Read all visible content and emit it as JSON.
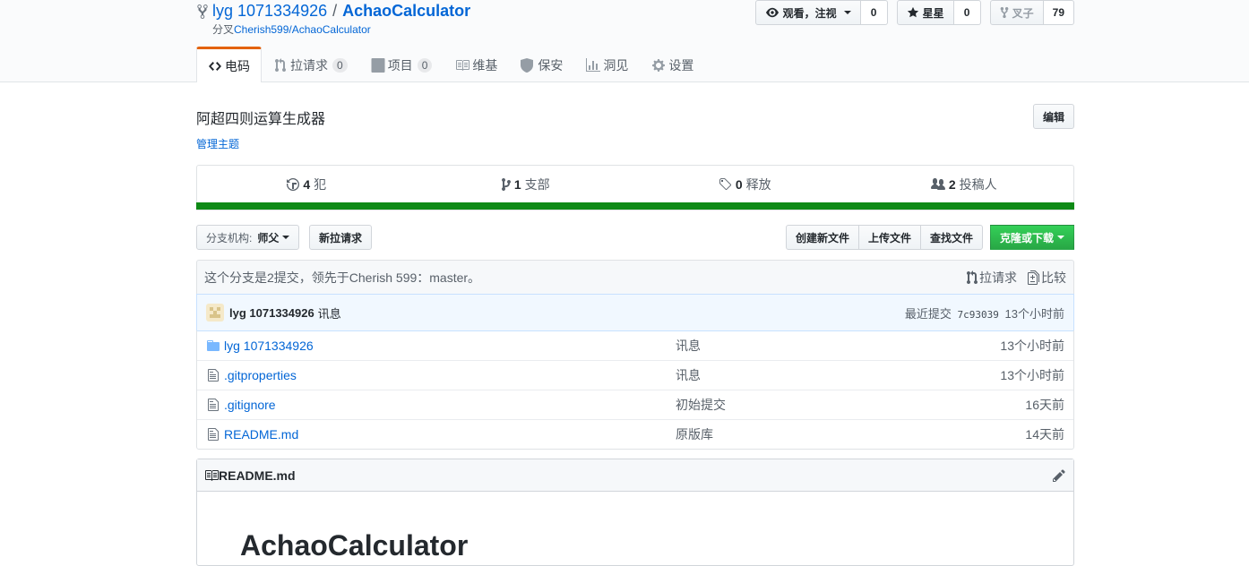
{
  "repo": {
    "owner": "lyg 1071334926",
    "separator": "/",
    "name": "AchaoCalculator",
    "forked_prefix": "分叉",
    "forked_from": "Cherish599/AchaoCalculator"
  },
  "actions": {
    "watch_label": "观看，注视",
    "watch_count": "0",
    "star_label": "星星",
    "star_count": "0",
    "fork_label": "叉子",
    "fork_count": "79"
  },
  "tabs": [
    {
      "label": "电码",
      "counter": ""
    },
    {
      "label": "拉请求",
      "counter": "0"
    },
    {
      "label": "项目",
      "counter": "0"
    },
    {
      "label": "维基",
      "counter": ""
    },
    {
      "label": "保安",
      "counter": ""
    },
    {
      "label": "洞见",
      "counter": ""
    },
    {
      "label": "设置",
      "counter": ""
    }
  ],
  "description": "阿超四则运算生成器",
  "manage_topics": "管理主题",
  "edit_label": "编辑",
  "numbers": {
    "commits": {
      "count": "4",
      "label": "犯"
    },
    "branches": {
      "count": "1",
      "label": "支部"
    },
    "releases": {
      "count": "0",
      "label": "释放"
    },
    "contributors": {
      "count": "2",
      "label": "投稿人"
    }
  },
  "language_color": "#0e8a16",
  "file_nav": {
    "branch_label": "分支机构:",
    "branch_value": "师父",
    "new_pr": "新拉请求",
    "create_file": "创建新文件",
    "upload_files": "上传文件",
    "find_file": "查找文件",
    "clone_download": "克隆或下载"
  },
  "branch_info": {
    "text": "这个分支是2提交，领先于Cherish 599：master。",
    "pull_request": "拉请求",
    "compare": "比较"
  },
  "latest_commit": {
    "author": "lyg 1071334926",
    "message": "讯息",
    "prefix": "最近提交",
    "sha": "7c93039",
    "age": "13个小时前"
  },
  "files": [
    {
      "type": "dir",
      "name": "lyg 1071334926",
      "message": "讯息",
      "age": "13个小时前"
    },
    {
      "type": "file",
      "name": ".gitproperties",
      "message": "讯息",
      "age": "13个小时前"
    },
    {
      "type": "file",
      "name": ".gitignore",
      "message": "初始提交",
      "age": "16天前"
    },
    {
      "type": "file",
      "name": "README.md",
      "message": "原版库",
      "age": "14天前"
    }
  ],
  "readme": {
    "filename": "README.md",
    "heading": "AchaoCalculator"
  }
}
